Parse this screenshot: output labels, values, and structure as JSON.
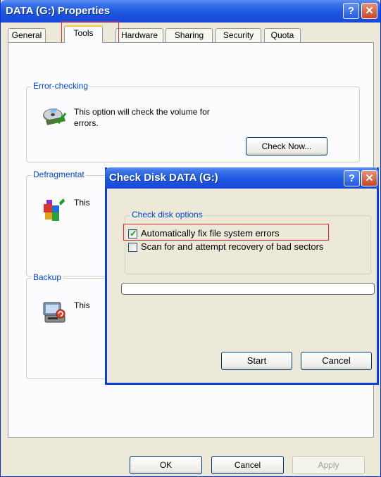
{
  "window": {
    "title": "DATA (G:) Properties",
    "help_glyph": "?",
    "close_glyph": "✕"
  },
  "tabs": [
    {
      "label": "General",
      "active": false
    },
    {
      "label": "Tools",
      "active": true
    },
    {
      "label": "Hardware",
      "active": false
    },
    {
      "label": "Sharing",
      "active": false
    },
    {
      "label": "Security",
      "active": false
    },
    {
      "label": "Quota",
      "active": false
    }
  ],
  "tools": {
    "error_checking": {
      "legend": "Error-checking",
      "description_line1": "This option will check the volume for",
      "description_line2": "errors.",
      "button": "Check Now...",
      "icon": "disk-check-icon"
    },
    "defrag": {
      "legend": "Defragmentat",
      "description": "This",
      "icon": "defragment-icon"
    },
    "backup": {
      "legend": "Backup",
      "description": "This",
      "icon": "backup-icon"
    }
  },
  "footer": {
    "ok": "OK",
    "cancel": "Cancel",
    "apply": "Apply"
  },
  "dialog": {
    "title": "Check Disk DATA (G:)",
    "help_glyph": "?",
    "close_glyph": "✕",
    "options_legend": "Check disk options",
    "option_autofix": {
      "label": "Automatically fix file system errors",
      "checked": true
    },
    "option_scan": {
      "label": "Scan for and attempt recovery of bad sectors",
      "checked": false
    },
    "progress": 0,
    "start": "Start",
    "cancel": "Cancel"
  },
  "colors": {
    "titlebar_blue": "#1d56e0",
    "highlight_red": "#e8262c",
    "legend_blue": "#0046d5",
    "window_face": "#ece9d8"
  }
}
